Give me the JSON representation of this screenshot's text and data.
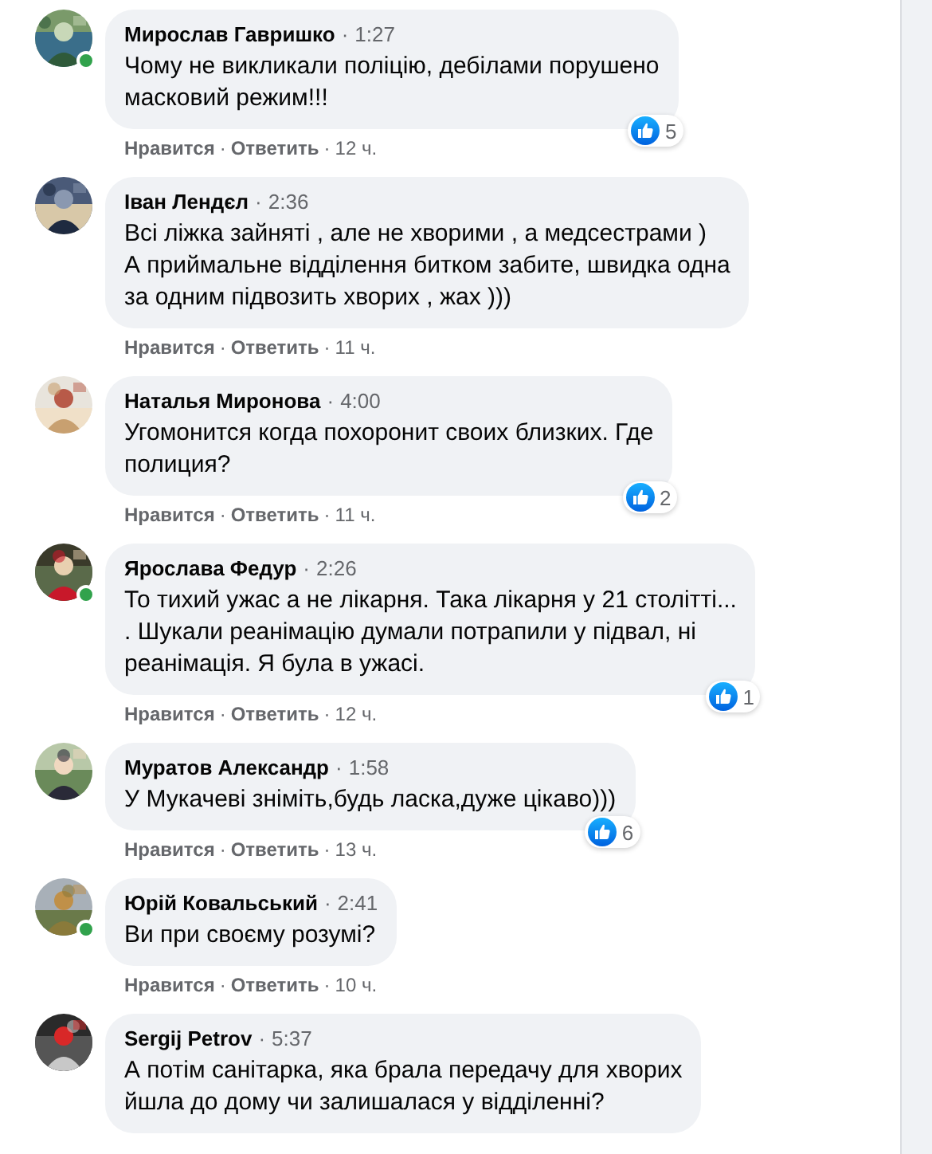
{
  "separator": "·",
  "comments": [
    {
      "author": "Мирослав Гавришко",
      "time": "1:27",
      "online": true,
      "lines": [
        "Чому не викликали поліцію, дебілами порушено",
        "масковий режим!!!"
      ],
      "actions": [
        "Нравится",
        "Ответить"
      ],
      "age": "12 ч.",
      "reactions": "5"
    },
    {
      "author": "Іван Лендєл",
      "time": "2:36",
      "online": false,
      "lines": [
        "Всі ліжка зайняті , але не хворими , а медсестрами )",
        "А приймальне відділення битком забите, швидка одна",
        "за одним підвозить хворих , жах )))"
      ],
      "actions": [
        "Нравится",
        "Ответить"
      ],
      "age": "11 ч."
    },
    {
      "author": "Наталья Миронова",
      "time": "4:00",
      "online": false,
      "lines": [
        "Угомонится когда похоронит своих близких. Где",
        "полиция?"
      ],
      "actions": [
        "Нравится",
        "Ответить"
      ],
      "age": "11 ч.",
      "reactions": "2"
    },
    {
      "author": "Ярослава Федур",
      "time": "2:26",
      "online": true,
      "lines": [
        "То тихий ужас а не лікарня. Така лікарня у 21 столітті...",
        ". Шукали реанімацію думали потрапили у підвал, ні",
        "реанімація. Я була в ужасі."
      ],
      "actions": [
        "Нравится",
        "Ответить"
      ],
      "age": "12 ч.",
      "reactions": "1"
    },
    {
      "author": "Муратов Александр",
      "time": "1:58",
      "online": false,
      "lines": [
        "У Мукачеві зніміть,будь ласка,дуже цікаво)))"
      ],
      "actions": [
        "Нравится",
        "Ответить"
      ],
      "age": "13 ч.",
      "reactions": "6"
    },
    {
      "author": "Юрій Ковальський",
      "time": "2:41",
      "online": true,
      "lines": [
        "Ви при своєму розумі?"
      ],
      "actions": [
        "Нравится",
        "Ответить"
      ],
      "age": "10 ч."
    },
    {
      "author": "Sergij Petrov",
      "time": "5:37",
      "online": false,
      "lines": [
        "А потім санітарка, яка брала передачу для хворих",
        "йшла до дому чи залишалася у відділенні?"
      ]
    }
  ]
}
